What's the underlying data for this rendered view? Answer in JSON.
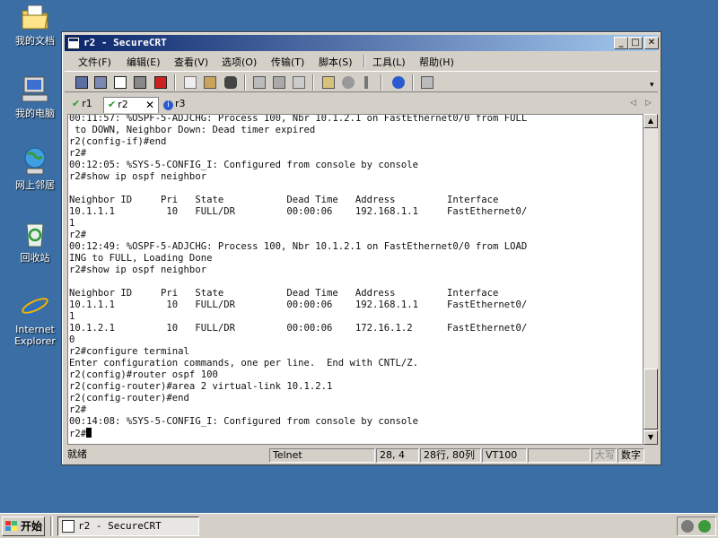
{
  "desktop": {
    "icons": [
      {
        "label": "我的文档",
        "icon": "my-documents-icon"
      },
      {
        "label": "我的电脑",
        "icon": "my-computer-icon"
      },
      {
        "label": "网上邻居",
        "icon": "network-places-icon"
      },
      {
        "label": "回收站",
        "icon": "recycle-bin-icon"
      },
      {
        "label": "Internet Explorer",
        "icon": "internet-explorer-icon"
      }
    ]
  },
  "window": {
    "title": "r2 - SecureCRT",
    "menu": [
      "文件(F)",
      "编辑(E)",
      "查看(V)",
      "选项(O)",
      "传输(T)",
      "脚本(S)",
      "工具(L)",
      "帮助(H)"
    ],
    "tabs": [
      {
        "label": "r1",
        "status": "connected"
      },
      {
        "label": "r2",
        "status": "connected",
        "active": true
      },
      {
        "label": "r3",
        "status": "info"
      }
    ],
    "tab_close": "✕",
    "terminal_lines": [
      "00:11:57: %OSPF-5-ADJCHG: Process 100, Nbr 10.1.2.1 on FastEthernet0/0 from FULL",
      " to DOWN, Neighbor Down: Dead timer expired",
      "r2(config-if)#end",
      "r2#",
      "00:12:05: %SYS-5-CONFIG_I: Configured from console by console",
      "r2#show ip ospf neighbor",
      "",
      "Neighbor ID     Pri   State           Dead Time   Address         Interface",
      "10.1.1.1         10   FULL/DR         00:00:06    192.168.1.1     FastEthernet0/",
      "1",
      "r2#",
      "00:12:49: %OSPF-5-ADJCHG: Process 100, Nbr 10.1.2.1 on FastEthernet0/0 from LOAD",
      "ING to FULL, Loading Done",
      "r2#show ip ospf neighbor",
      "",
      "Neighbor ID     Pri   State           Dead Time   Address         Interface",
      "10.1.1.1         10   FULL/DR         00:00:06    192.168.1.1     FastEthernet0/",
      "1",
      "10.1.2.1         10   FULL/DR         00:00:06    172.16.1.2      FastEthernet0/",
      "0",
      "r2#configure terminal",
      "Enter configuration commands, one per line.  End with CNTL/Z.",
      "r2(config)#router ospf 100",
      "r2(config-router)#area 2 virtual-link 10.1.2.1",
      "r2(config-router)#end",
      "r2#",
      "00:14:08: %SYS-5-CONFIG_I: Configured from console by console",
      "r2#"
    ],
    "status": {
      "ready": "就绪",
      "protocol": "Telnet",
      "cursor_pos": "28,  4",
      "dimensions": "28行, 80列",
      "emulation": "VT100",
      "caps": "大写",
      "num": "数字"
    }
  },
  "taskbar": {
    "start_label": "开始",
    "task_title": "r2 - SecureCRT"
  }
}
